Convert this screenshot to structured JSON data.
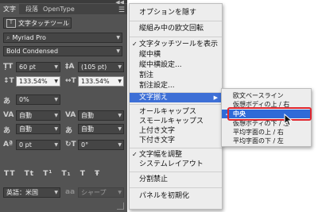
{
  "panel": {
    "tabs": [
      {
        "label": "文字",
        "active": true
      },
      {
        "label": "段落",
        "active": false
      },
      {
        "label": "OpenType",
        "active": false
      }
    ],
    "touch_tool_label": "文字タッチツール",
    "font_family": "Myriad Pro",
    "font_style": "Bold Condensed",
    "font_size": "60 pt",
    "leading": "(105 pt)",
    "vertical_scale": "133.54%",
    "horizontal_scale": "133.54%",
    "tsume": "0%",
    "kerning": "自動",
    "tracking": "自動",
    "aki_left": "自動",
    "aki_right": "自動",
    "baseline_shift": "0 pt",
    "rotation": "0°",
    "type_style_buttons": [
      "TT",
      "Tt",
      "T¹",
      "T₁",
      "T",
      "Ŧ"
    ],
    "language": "英語：米国",
    "antialias": "シャープ",
    "accent_color": "#3d6fd6"
  },
  "menu": {
    "items": [
      {
        "label": "オプションを隠す",
        "checked": false
      },
      {
        "label": "縦組み中の欧文回転",
        "checked": false
      },
      {
        "label": "文字タッチツールを表示",
        "checked": true
      },
      {
        "label": "縦中横",
        "checked": false
      },
      {
        "label": "縦中横設定...",
        "checked": false
      },
      {
        "label": "割注",
        "checked": false
      },
      {
        "label": "割注設定...",
        "checked": false
      },
      {
        "label": "文字揃え",
        "checked": false,
        "highlighted": true,
        "submenu_arrow": "▶"
      },
      {
        "label": "オールキャップス",
        "checked": false
      },
      {
        "label": "スモールキャップス",
        "checked": false
      },
      {
        "label": "上付き文字",
        "checked": false
      },
      {
        "label": "下付き文字",
        "checked": false
      },
      {
        "label": "文字幅を調整",
        "checked": true
      },
      {
        "label": "システムレイアウト",
        "checked": false
      },
      {
        "label": "分割禁止",
        "checked": false
      },
      {
        "label": "パネルを初期化",
        "checked": false
      }
    ]
  },
  "submenu": {
    "items": [
      {
        "label": "欧文ベースライン",
        "checked": false
      },
      {
        "label": "仮想ボディの上 / 右",
        "checked": false
      },
      {
        "label": "中央",
        "checked": true,
        "highlighted": true
      },
      {
        "label": "仮想ボディの下 / 左",
        "checked": false
      },
      {
        "label": "平均字面の上 / 右",
        "checked": false
      },
      {
        "label": "平均字面の下 / 左",
        "checked": false
      }
    ],
    "callout_color": "#e0262e"
  }
}
